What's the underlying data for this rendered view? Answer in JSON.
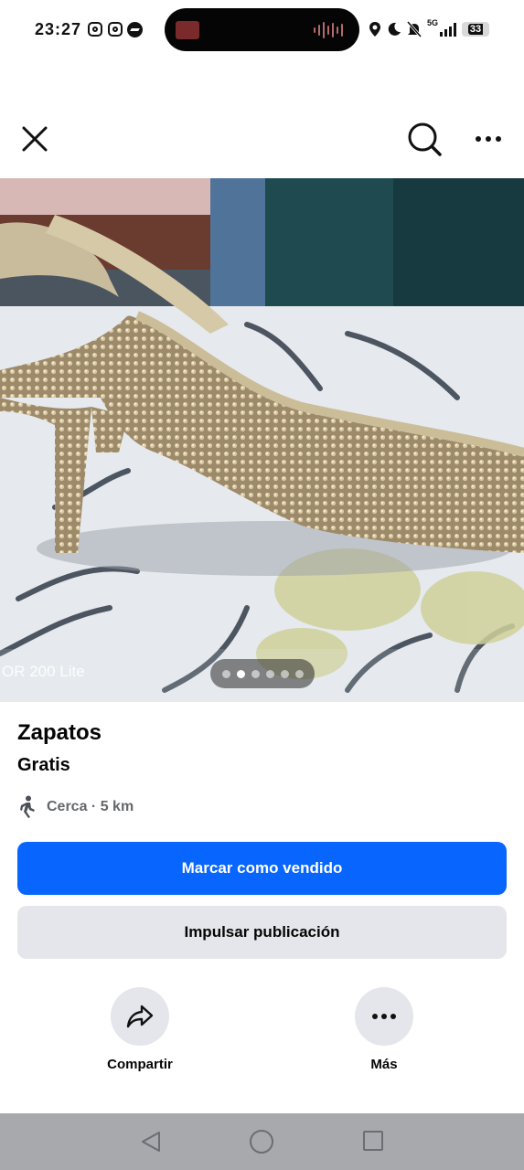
{
  "status_bar": {
    "time": "23:27",
    "network": "5G",
    "battery": "33",
    "icons": [
      "instagram-icon",
      "instagram-icon",
      "messenger-icon",
      "location-icon",
      "moon-icon",
      "bell-muted-icon",
      "signal-icon",
      "battery-icon"
    ]
  },
  "nav": {
    "icons": [
      "close-icon",
      "search-icon",
      "more-icon"
    ]
  },
  "photo": {
    "watermark": "OR 200 Lite",
    "pagination_count": 6,
    "pagination_active": 1
  },
  "listing": {
    "title": "Zapatos",
    "price": "Gratis",
    "distance": "Cerca · 5 km"
  },
  "buttons": {
    "mark_sold": "Marcar como vendido",
    "boost": "Impulsar publicación"
  },
  "actions": {
    "share": "Compartir",
    "more": "Más"
  },
  "colors": {
    "primary": "#0866ff",
    "secondary_bg": "#e4e6eb",
    "muted_text": "#65676b"
  }
}
